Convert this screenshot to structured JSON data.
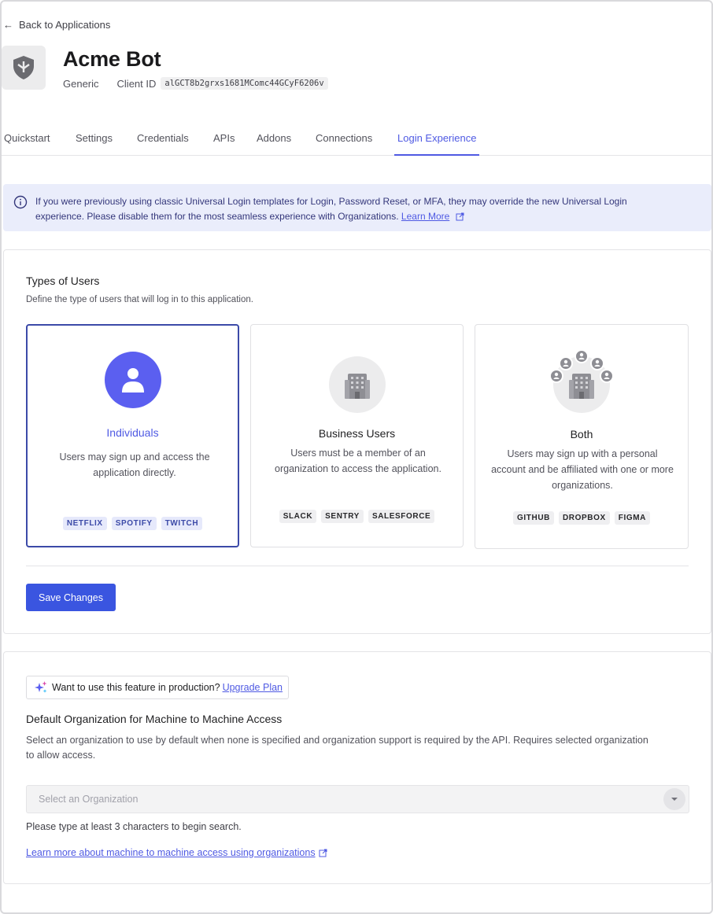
{
  "header": {
    "back_label": "Back to Applications",
    "app_name": "Acme Bot",
    "app_type": "Generic",
    "client_id_label": "Client ID",
    "client_id": "alGCT8b2grxs1681MComc44GCyF6206v"
  },
  "tabs": [
    {
      "label": "Quickstart",
      "active": false
    },
    {
      "label": "Settings",
      "active": false
    },
    {
      "label": "Credentials",
      "active": false
    },
    {
      "label": "APIs",
      "active": false
    },
    {
      "label": "Addons",
      "active": false
    },
    {
      "label": "Connections",
      "active": false
    },
    {
      "label": "Login Experience",
      "active": true
    }
  ],
  "notice": {
    "text": "If you were previously using classic Universal Login templates for Login, Password Reset, or MFA, they may override the new Universal Login experience. Please disable them for the most seamless experience with Organizations.",
    "link_label": "Learn More"
  },
  "user_types": {
    "title": "Types of Users",
    "description": "Define the type of users that will log in to this application.",
    "options": [
      {
        "name": "Individuals",
        "description": "Users may sign up and access the application directly.",
        "badges": [
          "NETFLIX",
          "SPOTIFY",
          "TWITCH"
        ],
        "selected": true
      },
      {
        "name": "Business Users",
        "description": "Users must be a member of an organization to access the application.",
        "badges": [
          "SLACK",
          "SENTRY",
          "SALESFORCE"
        ],
        "selected": false
      },
      {
        "name": "Both",
        "description": "Users may sign up with a personal account and be affiliated with one or more organizations.",
        "badges": [
          "GITHUB",
          "DROPBOX",
          "FIGMA"
        ],
        "selected": false
      }
    ],
    "save_label": "Save Changes"
  },
  "m2m": {
    "upgrade_prompt": "Want to use this feature in production?",
    "upgrade_link": "Upgrade Plan",
    "title": "Default Organization for Machine to Machine Access",
    "description": "Select an organization to use by default when none is specified and organization support is required by the API. Requires selected organization to allow access.",
    "select_placeholder": "Select an Organization",
    "hint": "Please type at least 3 characters to begin search.",
    "learn_link": "Learn more about machine to machine access using organizations"
  },
  "colors": {
    "accent": "#4f5ae3",
    "primary_button": "#3a55e0",
    "selected_border": "#3c4aa8",
    "notice_bg": "#eaedfb",
    "individuals_circle": "#5b5ff0"
  }
}
